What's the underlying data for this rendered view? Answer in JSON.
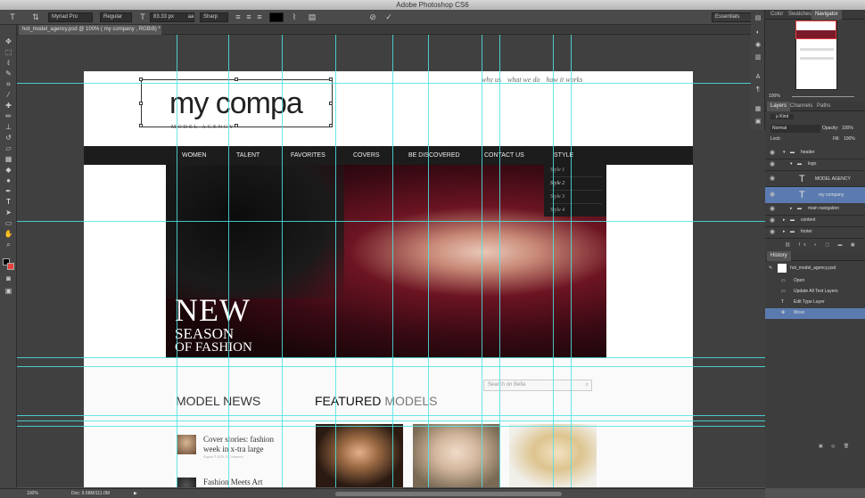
{
  "app": {
    "title": "Adobe Photoshop CS6"
  },
  "options": {
    "font_family": "Myriad Pro",
    "font_style": "Regular",
    "font_size": "83.33 px",
    "antialias": "Sharp",
    "aa_prefix": "aa",
    "workspace": "Essentials"
  },
  "tools": [
    "move-tool",
    "marquee-tool",
    "lasso-tool",
    "quick-select-tool",
    "crop-tool",
    "eyedropper-tool",
    "healing-brush-tool",
    "brush-tool",
    "clone-stamp-tool",
    "history-brush-tool",
    "eraser-tool",
    "gradient-tool",
    "blur-tool",
    "dodge-tool",
    "pen-tool",
    "type-tool",
    "path-select-tool",
    "shape-tool",
    "hand-tool",
    "zoom-tool"
  ],
  "document": {
    "tab_label": "hot_model_agency.psd @ 100% ( my company , RGB/8) *"
  },
  "site": {
    "logo_text": "my compa",
    "logo_sub": "MODEL AGENCY",
    "top_links": [
      "why us",
      "what we do",
      "how it works"
    ],
    "nav": [
      "WOMEN",
      "TALENT",
      "FAVORITES",
      "COVERS",
      "BE DISCOVERED",
      "CONTACT US",
      "STYLE"
    ],
    "style_menu": [
      "Style 1",
      "Style 2",
      "Style 3",
      "Style 4"
    ],
    "hero": {
      "line1": "NEW",
      "line2": "SEASON",
      "line3": "OF FASHION"
    },
    "search_placeholder": "Search on Bella",
    "news_heading": "MODEL NEWS",
    "featured_heading_1": "FEATURED",
    "featured_heading_2": "MODELS",
    "news": [
      {
        "title": "Cover stories: fashion week in x-tra large",
        "meta": "August 9 2010, 8 Comments"
      },
      {
        "title": "Fashion Meets Art",
        "meta": ""
      }
    ]
  },
  "panels": {
    "top_tabs": [
      "Color",
      "Swatches",
      "Navigator"
    ],
    "nav_zoom": "100%",
    "layers_tabs": [
      "Layers",
      "Channels",
      "Paths"
    ],
    "layers_kind": "ρ Kind",
    "blend_mode": "Normal",
    "opacity_label": "Opacity:",
    "opacity": "100%",
    "lock_label": "Lock:",
    "fill_label": "Fill:",
    "fill": "100%",
    "layers": [
      {
        "name": "header",
        "kind": "folder"
      },
      {
        "name": "logo",
        "kind": "folder"
      },
      {
        "name": "MODEL AGENCY",
        "kind": "text"
      },
      {
        "name": "my company",
        "kind": "text",
        "selected": true
      },
      {
        "name": "main navigation",
        "kind": "folder"
      },
      {
        "name": "content",
        "kind": "folder"
      },
      {
        "name": "footer",
        "kind": "folder"
      }
    ],
    "history_tab": "History",
    "history_snapshot": "hot_model_agency.psd",
    "history": [
      "Open",
      "Update All Text Layers",
      "Edit Type Layer",
      "Move"
    ]
  },
  "status": {
    "zoom": "100%",
    "doc": "Doc: 9.58M/111.0M"
  }
}
